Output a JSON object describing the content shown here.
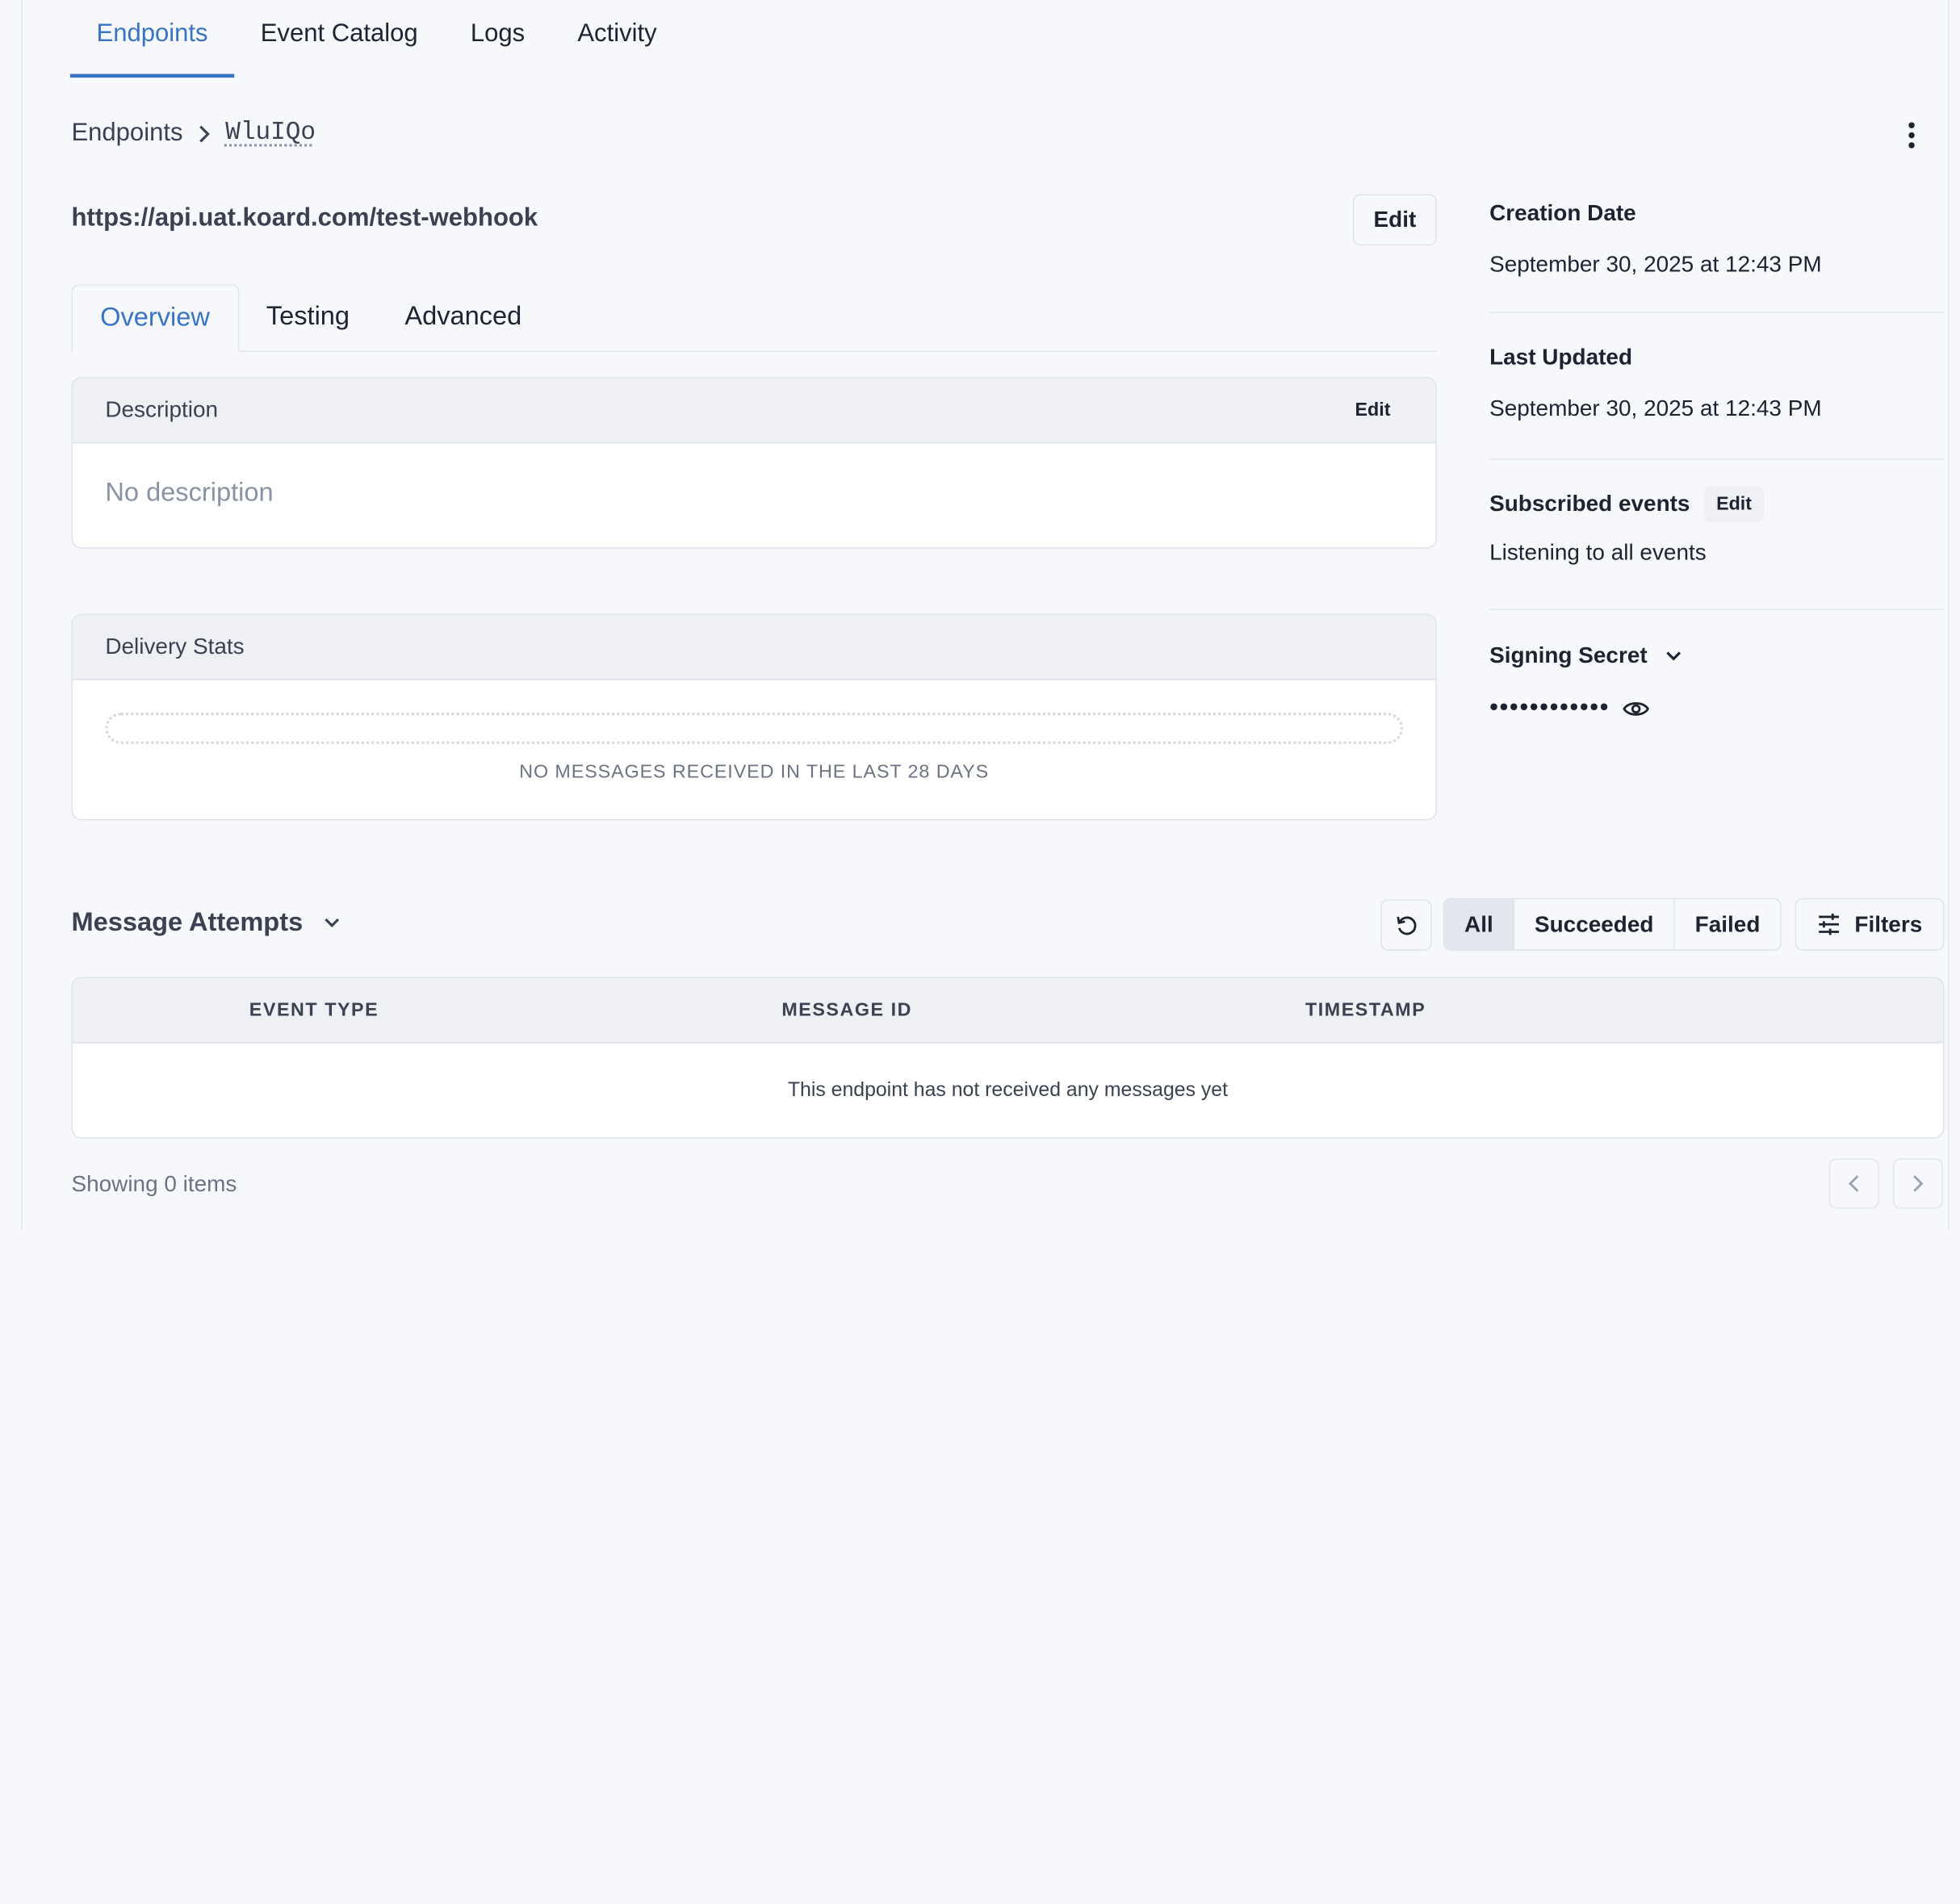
{
  "top_nav": {
    "tabs": [
      {
        "label": "Endpoints",
        "active": true
      },
      {
        "label": "Event Catalog",
        "active": false
      },
      {
        "label": "Logs",
        "active": false
      },
      {
        "label": "Activity",
        "active": false
      }
    ]
  },
  "breadcrumb": {
    "parent": "Endpoints",
    "current": "WluIQo"
  },
  "endpoint": {
    "url": "https://api.uat.koard.com/test-webhook",
    "edit_label": "Edit"
  },
  "sub_tabs": [
    {
      "label": "Overview",
      "active": true
    },
    {
      "label": "Testing",
      "active": false
    },
    {
      "label": "Advanced",
      "active": false
    }
  ],
  "description": {
    "title": "Description",
    "edit_label": "Edit",
    "text": "No description"
  },
  "delivery_stats": {
    "title": "Delivery Stats",
    "empty_text": "NO MESSAGES RECEIVED IN THE LAST 28 DAYS"
  },
  "meta": {
    "creation_label": "Creation Date",
    "creation_value": "September 30, 2025 at 12:43 PM",
    "updated_label": "Last Updated",
    "updated_value": "September 30, 2025 at 12:43 PM",
    "events_label": "Subscribed events",
    "events_edit": "Edit",
    "events_value": "Listening to all events",
    "secret_label": "Signing Secret",
    "secret_value": "••••••••••••"
  },
  "message_attempts": {
    "title": "Message Attempts",
    "filters": [
      {
        "label": "All",
        "active": true
      },
      {
        "label": "Succeeded",
        "active": false
      },
      {
        "label": "Failed",
        "active": false
      }
    ],
    "filters_button": "Filters",
    "columns": [
      "EVENT TYPE",
      "MESSAGE ID",
      "TIMESTAMP"
    ],
    "empty_text": "This endpoint has not received any messages yet",
    "showing": "Showing 0 items"
  },
  "colors": {
    "accent": "#3874c4",
    "header_bg": "#eef0f4",
    "border": "#dfe3ea",
    "muted": "#8a93a3"
  },
  "icons": [
    "chevron-right-icon",
    "kebab-menu-icon",
    "chevron-down-icon",
    "eye-icon",
    "refresh-icon",
    "sliders-icon",
    "chevron-left-icon"
  ]
}
